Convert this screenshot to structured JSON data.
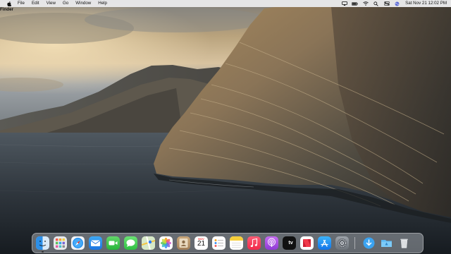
{
  "menubar": {
    "app_name": "Finder",
    "menus": [
      "File",
      "Edit",
      "View",
      "Go",
      "Window",
      "Help"
    ],
    "status_icons": [
      "screen-mirroring-icon",
      "battery-icon",
      "wifi-icon",
      "spotlight-search-icon",
      "control-center-icon",
      "siri-icon"
    ],
    "clock": "Sat Nov 21  12:02 PM"
  },
  "wallpaper": {
    "name": "macOS Catalina island"
  },
  "dock": {
    "apps": [
      {
        "name": "Finder",
        "icon": "finder-icon",
        "running": true
      },
      {
        "name": "Launchpad",
        "icon": "launchpad-icon",
        "running": false
      },
      {
        "name": "Safari",
        "icon": "safari-icon",
        "running": false
      },
      {
        "name": "Mail",
        "icon": "mail-icon",
        "running": false
      },
      {
        "name": "FaceTime",
        "icon": "facetime-icon",
        "running": false
      },
      {
        "name": "Messages",
        "icon": "messages-icon",
        "running": false
      },
      {
        "name": "Maps",
        "icon": "maps-icon",
        "running": false
      },
      {
        "name": "Photos",
        "icon": "photos-icon",
        "running": false
      },
      {
        "name": "Contacts",
        "icon": "contacts-icon",
        "running": false
      },
      {
        "name": "Calendar",
        "icon": "calendar-icon",
        "running": false
      },
      {
        "name": "Reminders",
        "icon": "reminders-icon",
        "running": false
      },
      {
        "name": "Notes",
        "icon": "notes-icon",
        "running": false
      },
      {
        "name": "Music",
        "icon": "music-icon",
        "running": false
      },
      {
        "name": "Podcasts",
        "icon": "podcasts-icon",
        "running": false
      },
      {
        "name": "TV",
        "icon": "apple-tv-icon",
        "running": false
      },
      {
        "name": "News",
        "icon": "news-icon",
        "running": false
      },
      {
        "name": "App Store",
        "icon": "app-store-icon",
        "running": false
      },
      {
        "name": "System Preferences",
        "icon": "system-preferences-icon",
        "running": false
      },
      {
        "name": "Downloads",
        "icon": "downloads-folder-icon",
        "running": false
      },
      {
        "name": "Trash",
        "icon": "trash-icon",
        "running": false
      }
    ],
    "calendar": {
      "month": "NOV",
      "day": "21"
    },
    "tv_label": "tv"
  }
}
